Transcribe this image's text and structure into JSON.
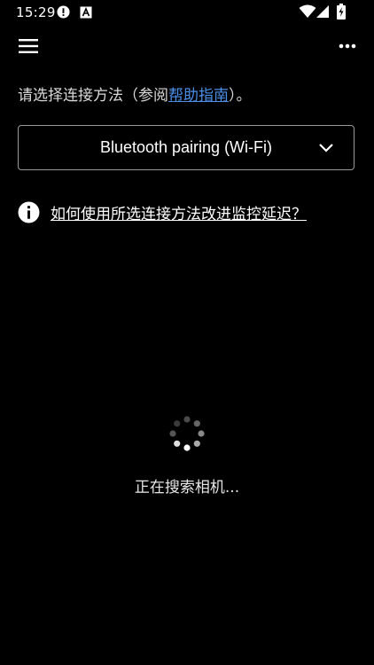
{
  "status_bar": {
    "time": "15:29",
    "icons": [
      "alert-circle-icon",
      "text-a-icon",
      "wifi-icon",
      "signal-icon",
      "battery-charging-icon"
    ]
  },
  "app_bar": {
    "menu_icon": "hamburger-menu-icon",
    "more_icon": "more-options-icon"
  },
  "instruction": {
    "before": "请选择连接方法（参阅",
    "link": "帮助指南",
    "after": "）。"
  },
  "method_select": {
    "selected": "Bluetooth pairing (Wi-Fi)",
    "icon": "chevron-down-icon"
  },
  "tip": {
    "icon": "info-icon",
    "link": "如何使用所选连接方法改进监控延迟？"
  },
  "loading": {
    "icon": "spinner-icon",
    "text": "正在搜索相机..."
  },
  "colors": {
    "background": "#000000",
    "link": "#4a8fe8",
    "border": "#9a9a9a"
  }
}
